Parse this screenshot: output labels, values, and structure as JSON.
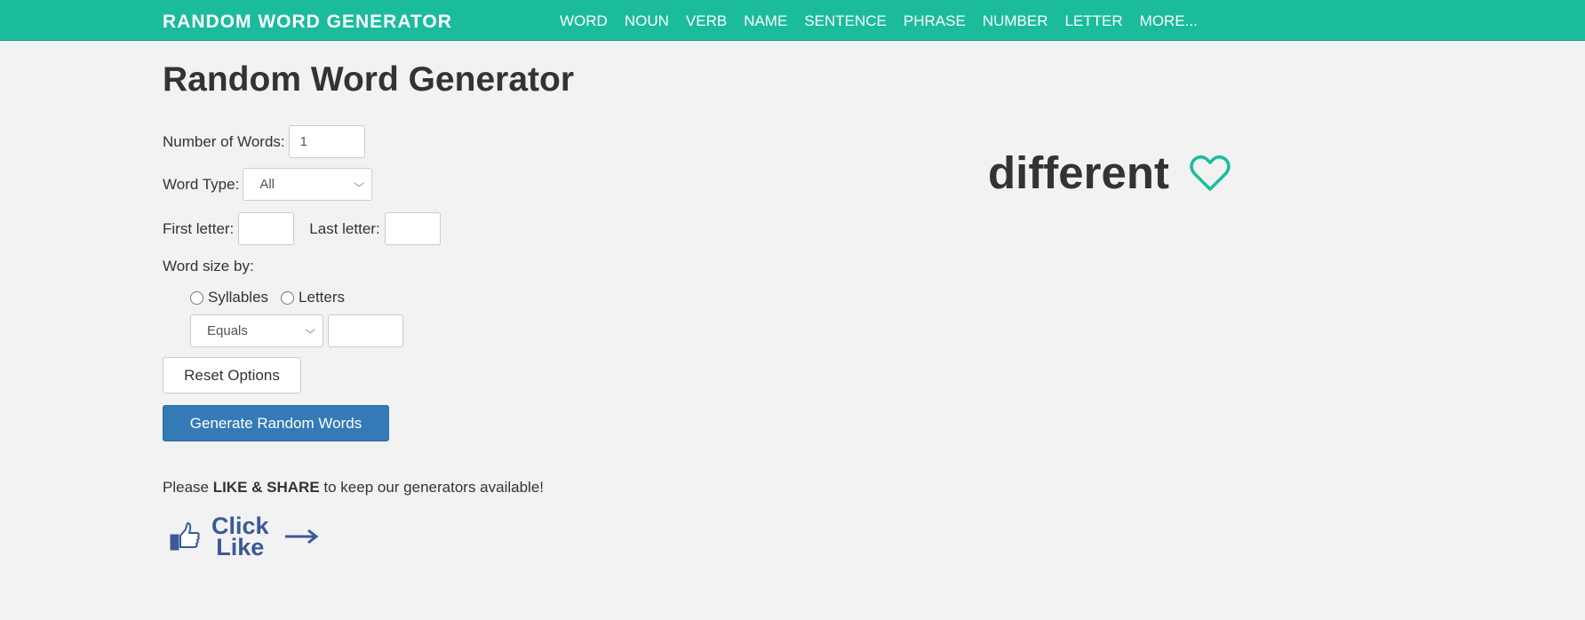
{
  "header": {
    "brand": "RANDOM WORD GENERATOR",
    "nav": [
      "WORD",
      "NOUN",
      "VERB",
      "NAME",
      "SENTENCE",
      "PHRASE",
      "NUMBER",
      "LETTER",
      "MORE..."
    ]
  },
  "main": {
    "title": "Random Word Generator",
    "form": {
      "num_words_label": "Number of Words:",
      "num_words_value": "1",
      "word_type_label": "Word Type:",
      "word_type_value": "All",
      "first_letter_label": "First letter:",
      "first_letter_value": "",
      "last_letter_label": "Last letter:",
      "last_letter_value": "",
      "size_by_label": "Word size by:",
      "radio_syllables": "Syllables",
      "radio_letters": "Letters",
      "comparison_value": "Equals",
      "size_value": "",
      "reset_label": "Reset Options",
      "generate_label": "Generate Random Words"
    },
    "share": {
      "prefix": "Please ",
      "bold": "LIKE & SHARE",
      "suffix": " to keep our generators available!",
      "click_line1": "Click",
      "click_line2": "Like"
    },
    "result": {
      "word": "different"
    }
  },
  "colors": {
    "header_bg": "#1abc9c",
    "primary_button": "#337ab7",
    "facebook_blue": "#3b5998",
    "heart": "#1abc9c"
  },
  "icons": {
    "like": "thumbs-up-icon",
    "arrow": "arrow-right-icon",
    "favorite": "heart-outline-icon",
    "select": "chevron-down-icon"
  }
}
